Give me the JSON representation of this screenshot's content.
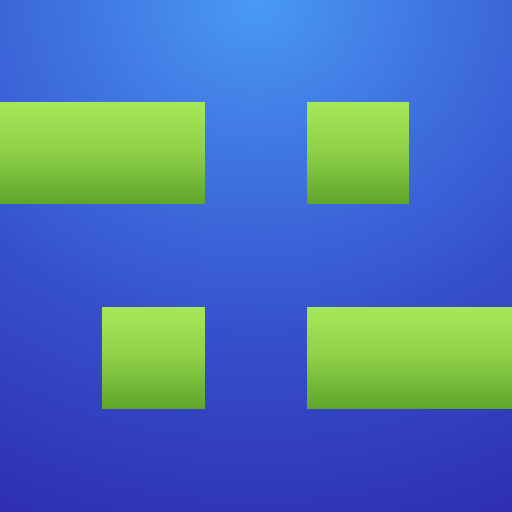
{
  "game": {
    "colors": {
      "background_center": "#4a9af5",
      "background_edge": "#2e2fb0",
      "block_top": "#a7e85a",
      "block_bottom": "#5ea52a"
    },
    "board": {
      "grid_columns": 5,
      "grid_rows": 5,
      "blocks": [
        {
          "name": "block",
          "row": 1,
          "col_start": 0,
          "span": 2
        },
        {
          "name": "block",
          "row": 1,
          "col_start": 3,
          "span": 1
        },
        {
          "name": "block",
          "row": 3,
          "col_start": 1,
          "span": 1
        },
        {
          "name": "block",
          "row": 3,
          "col_start": 3,
          "span": 2
        }
      ]
    }
  }
}
